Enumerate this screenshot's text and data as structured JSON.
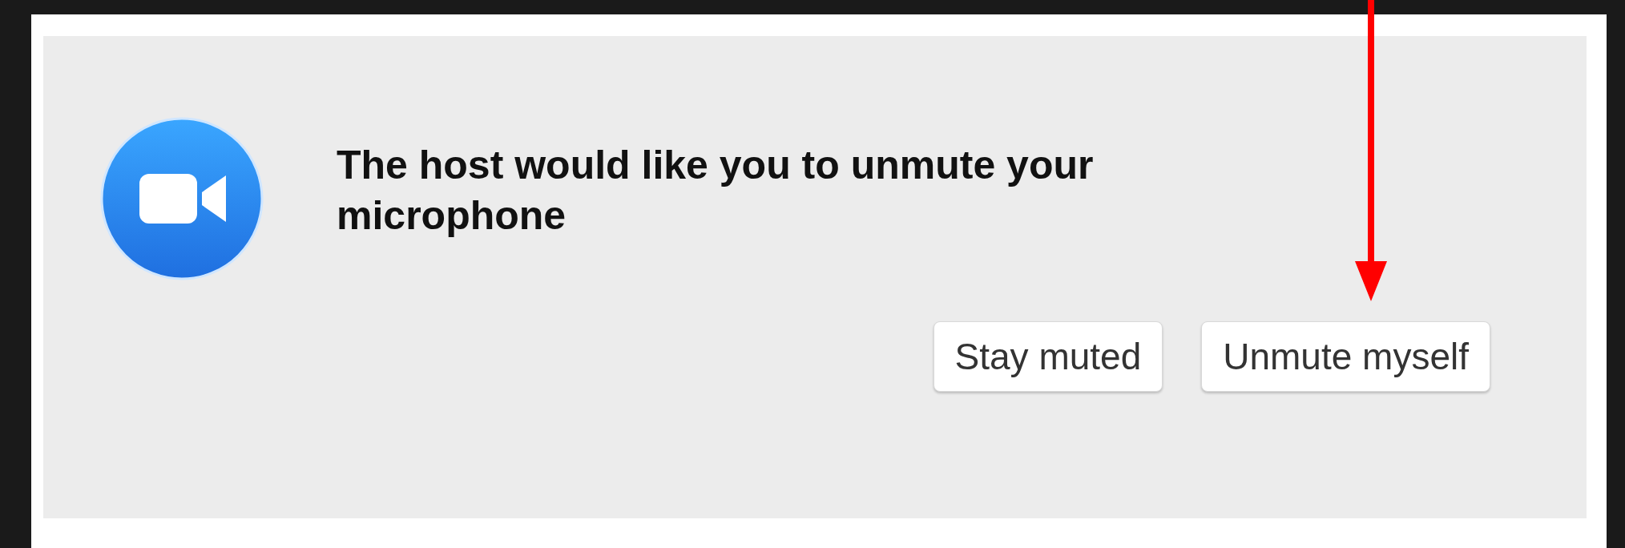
{
  "dialog": {
    "message": "The host would like you to unmute your microphone",
    "buttons": [
      "Stay muted",
      "Unmute myself"
    ]
  }
}
